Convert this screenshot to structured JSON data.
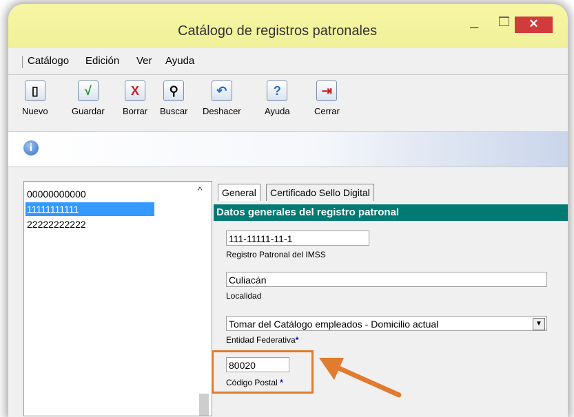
{
  "window": {
    "title": "Catálogo de registros patronales",
    "min_glyph": "–",
    "close_glyph": "✕"
  },
  "menu": [
    "Catálogo",
    "Edición",
    "Ver",
    "Ayuda"
  ],
  "toolbar": [
    {
      "label": "Nuevo",
      "icon": "new-document-icon",
      "glyph": "▯"
    },
    {
      "label": "Guardar",
      "icon": "checkmark-icon",
      "glyph": "√"
    },
    {
      "label": "Borrar",
      "icon": "delete-x-icon",
      "glyph": "X"
    },
    {
      "label": "Buscar",
      "icon": "binoculars-icon",
      "glyph": "⚲"
    },
    {
      "label": "Deshacer",
      "icon": "undo-icon",
      "glyph": "↶"
    },
    {
      "label": "Ayuda",
      "icon": "help-question-icon",
      "glyph": "?"
    },
    {
      "label": "Cerrar",
      "icon": "exit-door-icon",
      "glyph": "⇥"
    }
  ],
  "info_glyph": "i",
  "list": {
    "items": [
      "00000000000",
      "11111111111",
      "22222222222"
    ],
    "selected_index": 1
  },
  "tabs": [
    "General",
    "Certificado Sello Digital"
  ],
  "section_title": "Datos generales del registro patronal",
  "form": {
    "registro_value": "111-11111-11-1",
    "registro_label": "Registro Patronal del IMSS",
    "localidad_value": "Culiacán",
    "localidad_label": "Localidad",
    "entidad_value": "Tomar del Catálogo empleados - Domicilio actual",
    "entidad_label": "Entidad Federativa",
    "cp_value": "80020",
    "cp_label": "Código Postal",
    "required_mark": "*"
  },
  "colors": {
    "accent": "#007a73",
    "selection": "#3399ff",
    "highlight": "#e07b2f",
    "close": "#d13b3b"
  }
}
